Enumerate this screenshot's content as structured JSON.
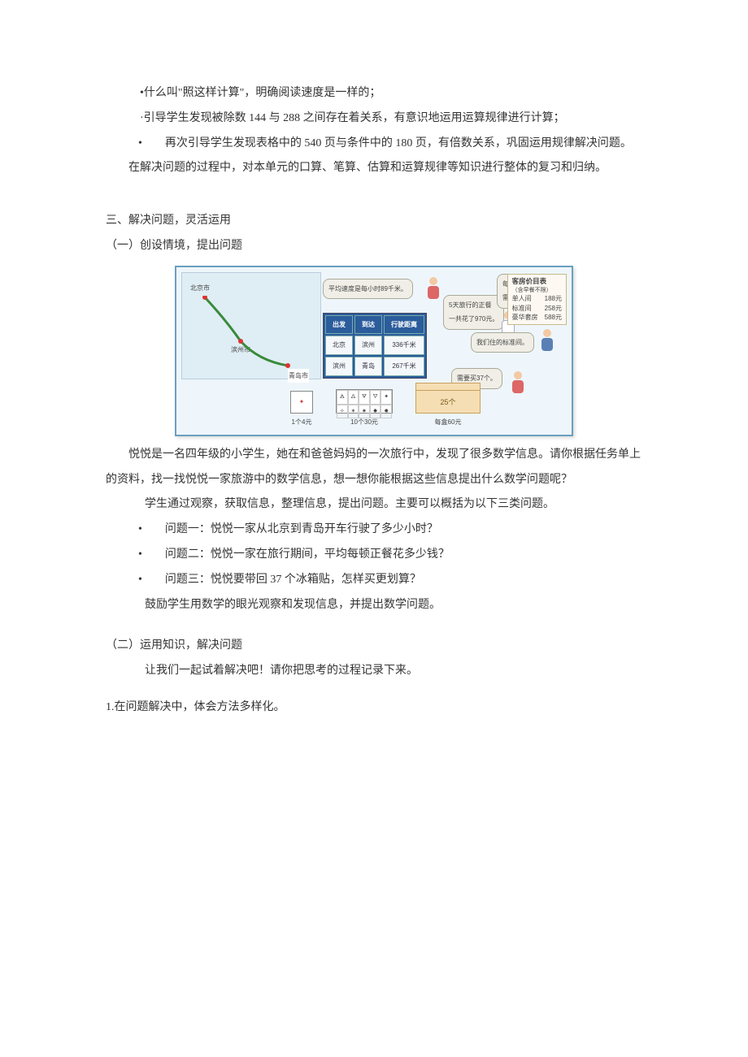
{
  "b1": "•什么叫\"照这样计算\"，明确阅读速度是一样的；",
  "b2": "·引导学生发现被除数 144 与 288 之间存在着关系，有意识地运用运算规律进行计算；",
  "b3": "•　　再次引导学生发现表格中的 540 页与条件中的 180 页，有倍数关系，巩固运用规律解决问题。",
  "p1": "在解决问题的过程中，对本单元的口算、笔算、估算和运算规律等知识进行整体的复习和归纳。",
  "h3": "三、解决问题，灵活运用",
  "h3a": "（一）创设情境，提出问题",
  "map": {
    "beijing": "北京市",
    "binzhou": "滨州市",
    "qingdao": "青岛市"
  },
  "table": {
    "h1": "出发",
    "h2": "到达",
    "h3": "行驶距离",
    "r1c1": "北京",
    "r1c2": "滨州",
    "r1c3": "336千米",
    "r2c1": "滨州",
    "r2c2": "青岛",
    "r2c3": "267千米"
  },
  "bub": {
    "speed": "平均速度是每小时89千米。",
    "meal1": "5天旅行的正餐",
    "meal2": "一共花了970元。",
    "ask1": "每天的午饭和晚饭",
    "ask2": "需要单独付钱。",
    "room": "我们住的标准间。",
    "buy": "需要买37个。"
  },
  "price": {
    "title": "客房价目表",
    "sub": "（含早餐不限）",
    "r1": "单人间　　188元",
    "r2": "标准间　　258元",
    "r3": "豪华套房　588元"
  },
  "goods": {
    "g1": "1个4元",
    "g2": "10个30元",
    "g3": "每盒60元",
    "boxlabel": "25个"
  },
  "p2": "悦悦是一名四年级的小学生，她在和爸爸妈妈的一次旅行中，发现了很多数学信息。请你根据任务单上的资料，找一找悦悦一家旅游中的数学信息，想一想你能根据这些信息提出什么数学问题呢？",
  "p3": "学生通过观察，获取信息，整理信息，提出问题。主要可以概括为以下三类问题。",
  "q1": "•　　问题一：悦悦一家从北京到青岛开车行驶了多少小时？",
  "q2": "•　　问题二：悦悦一家在旅行期间，平均每顿正餐花多少钱？",
  "q3": "•　　问题三：悦悦要带回 37 个冰箱贴，怎样买更划算？",
  "p4": "鼓励学生用数学的眼光观察和发现信息，并提出数学问题。",
  "h3b": "（二）运用知识，解决问题",
  "p5": "让我们一起试着解决吧！请你把思考的过程记录下来。",
  "p6": "1.在问题解决中，体会方法多样化。"
}
